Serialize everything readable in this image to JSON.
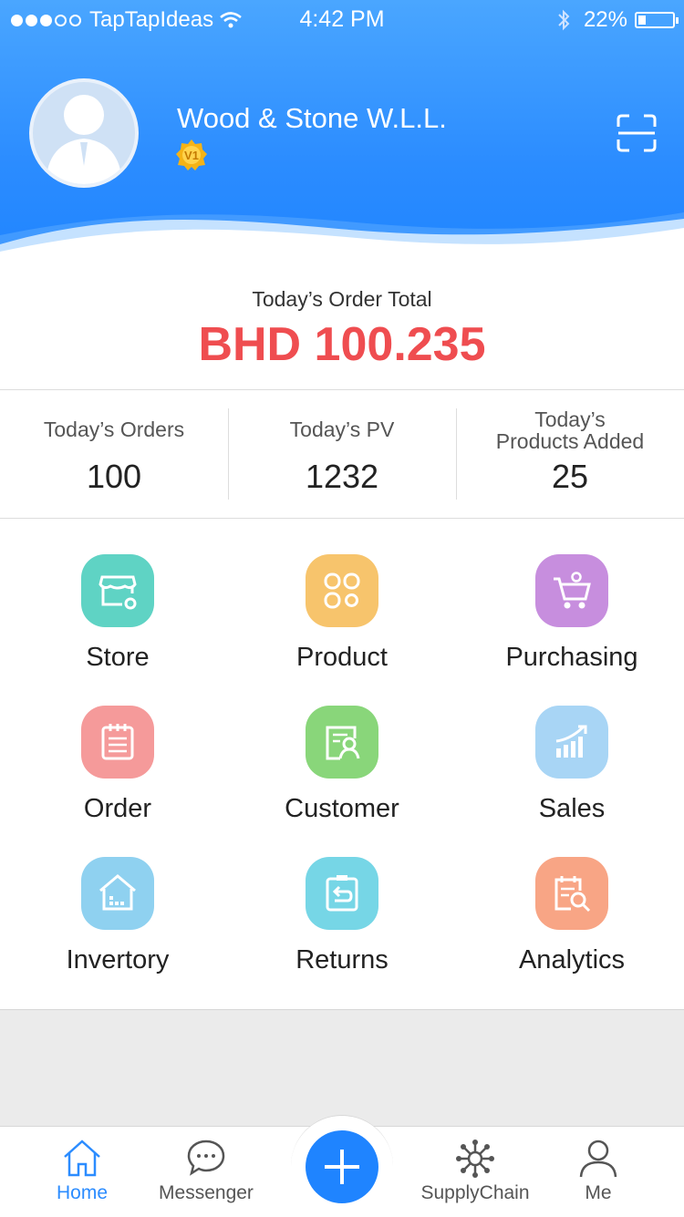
{
  "status_bar": {
    "carrier": "TapTapIdeas",
    "time": "4:42 PM",
    "battery": "22%",
    "battery_level": 0.22
  },
  "header": {
    "company_name": "Wood & Stone W.L.L.",
    "badge": "V1"
  },
  "summary": {
    "label": "Today’s Order Total",
    "amount": "BHD 100.235"
  },
  "stats": [
    {
      "label": "Today’s Orders",
      "value": "100"
    },
    {
      "label": "Today’s PV",
      "value": "1232"
    },
    {
      "label_line1": "Today’s",
      "label_line2": "Products Added",
      "value": "25"
    }
  ],
  "menu": [
    {
      "label": "Store",
      "icon": "store-icon",
      "color": "#5fd3c4"
    },
    {
      "label": "Product",
      "icon": "product-icon",
      "color": "#f7c46c"
    },
    {
      "label": "Purchasing",
      "icon": "purchasing-cart-icon",
      "color": "#c78ede"
    },
    {
      "label": "Order",
      "icon": "order-icon",
      "color": "#f59a9a"
    },
    {
      "label": "Customer",
      "icon": "customer-icon",
      "color": "#89d67a"
    },
    {
      "label": "Sales",
      "icon": "sales-chart-icon",
      "color": "#a8d5f5"
    },
    {
      "label": "Invertory",
      "icon": "inventory-icon",
      "color": "#8fd1f0"
    },
    {
      "label": "Returns",
      "icon": "returns-icon",
      "color": "#76d6e6"
    },
    {
      "label": "Analytics",
      "icon": "analytics-icon",
      "color": "#f8a585"
    }
  ],
  "bottom_nav": [
    {
      "label": "Home",
      "icon": "home-icon",
      "active": true
    },
    {
      "label": "Messenger",
      "icon": "messenger-icon"
    },
    {
      "label": "SupplyChain",
      "icon": "supply-chain-icon"
    },
    {
      "label": "Me",
      "icon": "user-icon"
    }
  ],
  "colors": {
    "primary": "#1f84ff",
    "amount": "#ef4d50"
  }
}
